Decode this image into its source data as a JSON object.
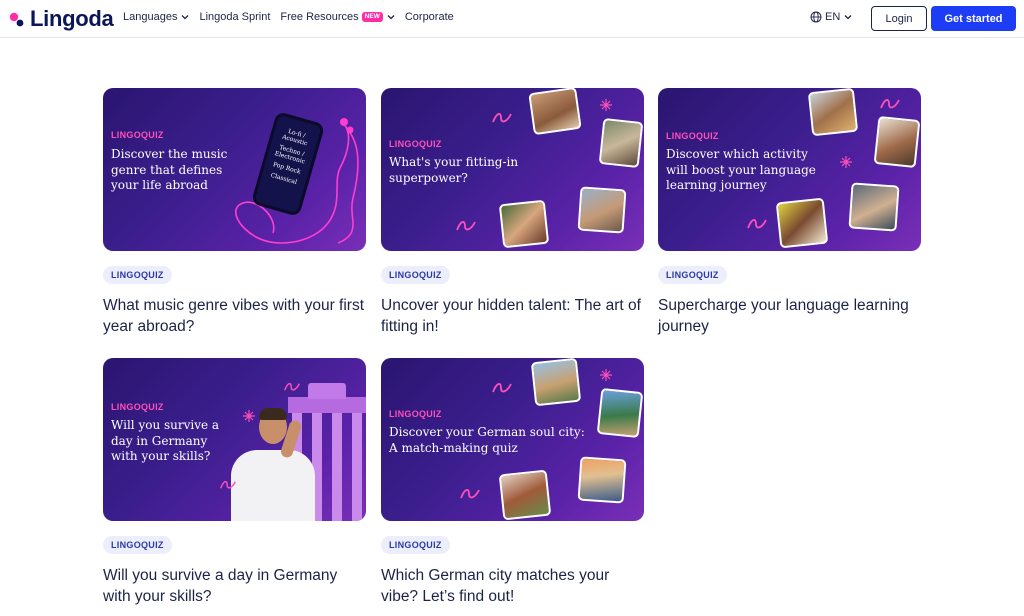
{
  "brand": {
    "name": "Lingoda"
  },
  "nav": {
    "languages": "Languages",
    "sprint": "Lingoda Sprint",
    "free_resources": "Free Resources",
    "new_badge": "NEW",
    "corporate": "Corporate"
  },
  "header_actions": {
    "language": "EN",
    "login": "Login",
    "get_started": "Get started"
  },
  "colors": {
    "brand_blue": "#1d3cf6",
    "brand_pink": "#ff2ea6",
    "navy": "#0b1659"
  },
  "cards": [
    {
      "banner_label": "LINGOQUIZ",
      "banner_title": "Discover the music genre that defines your life abroad",
      "phone_genres": [
        "Lo-fi / Acoustic",
        "Techno / Electronic",
        "Pop Rock",
        "Classical"
      ],
      "chip": "LINGOQUIZ",
      "title": "What music genre vibes with your first year abroad?"
    },
    {
      "banner_label": "LINGOQUIZ",
      "banner_title": "What's your fitting-in superpower?",
      "chip": "LINGOQUIZ",
      "title": "Uncover your hidden talent: The art of fitting in!"
    },
    {
      "banner_label": "LINGOQUIZ",
      "banner_title": "Discover which activity will boost your language learning journey",
      "chip": "LINGOQUIZ",
      "title": "Supercharge your language learning journey"
    },
    {
      "banner_label": "LINGOQUIZ",
      "banner_title": "Will you survive a day in Germany with your skills?",
      "chip": "LINGOQUIZ",
      "title": "Will you survive a day in Germany with your skills?"
    },
    {
      "banner_label": "LINGOQUIZ",
      "banner_title": "Discover your German soul city: A match-making quiz",
      "chip": "LINGOQUIZ",
      "title": "Which German city matches your vibe? Let’s find out!"
    }
  ]
}
